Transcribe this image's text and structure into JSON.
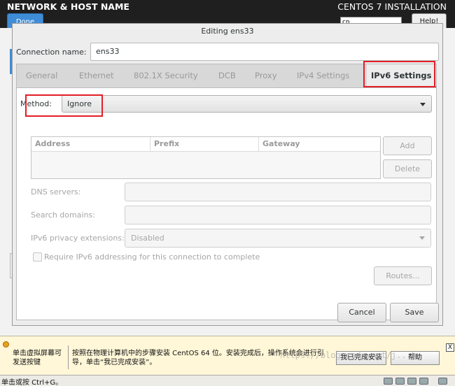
{
  "background": {
    "title": "NETWORK & HOST NAME",
    "installer_title": "CENTOS 7 INSTALLATION",
    "done_label": "Done",
    "keyboard_label": "cn",
    "help_label": "Help!"
  },
  "dialog": {
    "title": "Editing ens33",
    "connection_name_label": "Connection name:",
    "connection_name_value": "ens33",
    "tabs": [
      {
        "label": "General"
      },
      {
        "label": "Ethernet"
      },
      {
        "label": "802.1X Security"
      },
      {
        "label": "DCB"
      },
      {
        "label": "Proxy"
      },
      {
        "label": "IPv4 Settings"
      },
      {
        "label": "IPv6 Settings",
        "active": true
      }
    ],
    "method_label": "Method:",
    "method_value": "Ignore",
    "address_columns": [
      "Address",
      "Prefix",
      "Gateway"
    ],
    "add_label": "Add",
    "delete_label": "Delete",
    "dns_label": "DNS servers:",
    "search_domains_label": "Search domains:",
    "privacy_label": "IPv6 privacy extensions:",
    "privacy_value": "Disabled",
    "require_label": "Require IPv6 addressing for this connection to complete",
    "routes_label": "Routes...",
    "cancel_label": "Cancel",
    "save_label": "Save"
  },
  "vm_bar": {
    "hint_left": "单击虚拟屏幕可发送按键",
    "hint_main": "按照在物理计算机中的步骤安装 CentOS 64 位。安装完成后，操作系统会进行引导，单击“我已完成安装”。",
    "done_install_label": "我已完成安装",
    "help_label": "帮助",
    "close_label": "X"
  },
  "status_bar": {
    "text": "单击或按 Ctrl+G。"
  },
  "watermark": "https://blog.csdn.net/j...h",
  "colors": {
    "accent": "#4a90d9",
    "highlight": "#e21e26"
  }
}
